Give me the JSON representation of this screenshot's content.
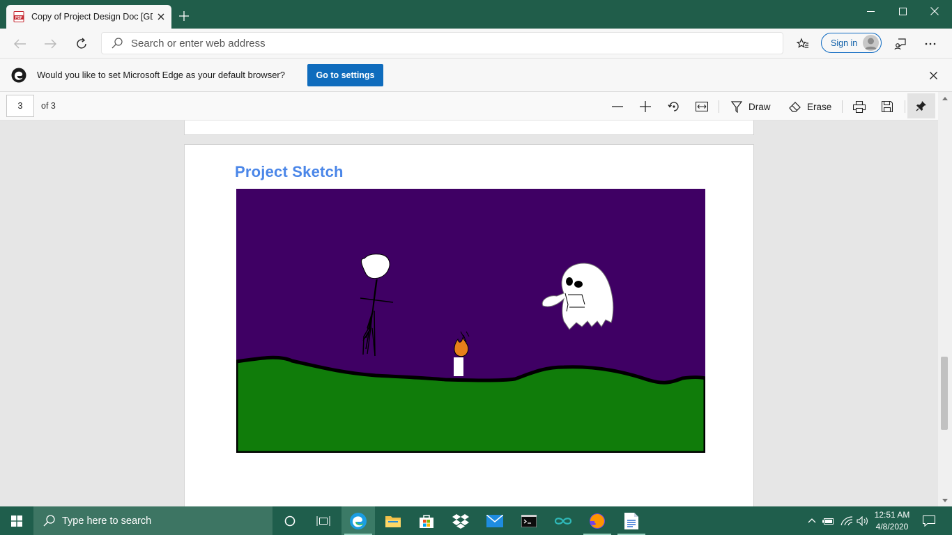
{
  "browser": {
    "tab_title": "Copy of Project Design Doc [GDC",
    "address_placeholder": "Search or enter web address",
    "sign_in_label": "Sign in"
  },
  "infobar": {
    "message": "Would you like to set Microsoft Edge as your default browser?",
    "button_label": "Go to settings"
  },
  "pdf_toolbar": {
    "current_page": "3",
    "page_count_label": "of 3",
    "draw_label": "Draw",
    "erase_label": "Erase"
  },
  "document": {
    "heading": "Project Sketch"
  },
  "colors": {
    "accent": "#0f6cbd",
    "heading": "#4a86e8",
    "sky": "#3f0064",
    "grass": "#107c0a",
    "titlebar": "#205d4a",
    "taskbar": "#1f5e4c"
  },
  "taskbar": {
    "search_placeholder": "Type here to search",
    "time": "12:51 AM",
    "date": "4/8/2020",
    "pinned": [
      "cortana-icon",
      "task-view-icon",
      "edge-icon",
      "file-explorer-icon",
      "store-icon",
      "dropbox-icon",
      "mail-icon",
      "terminal-icon",
      "arduino-icon",
      "firefox-icon",
      "document-icon"
    ]
  }
}
